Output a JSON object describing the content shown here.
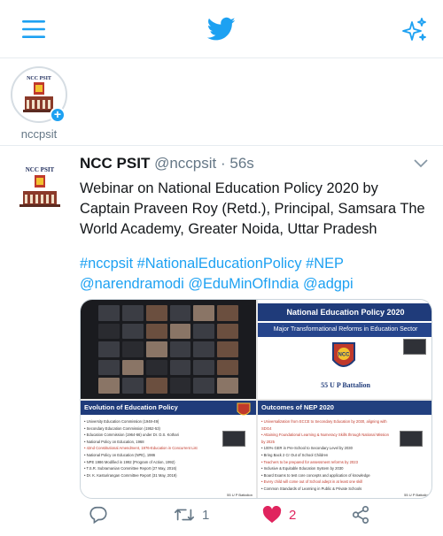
{
  "header": {
    "menu_icon": "hamburger-menu-icon",
    "logo_icon": "twitter-bird-icon",
    "sparkle_icon": "sparkle-icon",
    "accent": "#1da1f2"
  },
  "fleet": {
    "name": "nccpsit",
    "avatar_text": "NCC PSIT"
  },
  "tweet": {
    "avatar_text": "NCC PSIT",
    "name": "NCC PSIT",
    "handle": "@nccpsit",
    "separator": "·",
    "time": "56s",
    "text": "Webinar on National Education Policy 2020 by Captain Praveen Roy (Retd.), Principal, Samsara The World Academy, Greater Noida, Uttar Pradesh",
    "hashtags": "#nccpsit #NationalEducationPolicy #NEP @narendramodi @EduMinOfIndia @adgpi",
    "media": {
      "slide2_title": "National Education Policy 2020",
      "slide2_subtitle": "Major Transformational Reforms in Education Sector",
      "slide2_footer": "55 U P Battalion",
      "slide3_title": "Evolution of Education Policy",
      "slide3_items": [
        "• University Education Commission (1948-49)",
        "• Secondary Education Commission (1952-53)",
        "• Education Commission (1964-66) under Dr. D.S. Kothari",
        "• National Policy on Education, 1968",
        "• 42nd Constitutional Amendment, 1976-Education in Concurrent List",
        "• National Policy on Education (NPE), 1986",
        "• NPE 1986 Modified in 1992 (Program of Action, 1992)",
        "• T.S.R. Subramanian Committee Report (27 May, 2016)",
        "• Dr. K. Kasturirangan Committee Report (31 May, 2019)"
      ],
      "slide3_footer": "55 U P Battalion",
      "slide4_title": "Outcomes of NEP 2020",
      "slide4_items": [
        "• Universalization from ECCE to Secondary Education by 2030, aligning with SDG4",
        "• Attaining Foundational Learning & Numeracy Skills through National Mission by 2025",
        "• 100% GER in Pre-School to Secondary Level by 2030",
        "• Bring Back 2 Cr Out of School Children",
        "• Teachers to be prepared for assessment reforms by 2023",
        "• Inclusive & Equitable Education System by 2030",
        "• Board Exams to test core concepts and application of knowledge",
        "• Every child will come out of School adept in at least one skill",
        "• Common Standards of Learning in Public & Private Schools"
      ],
      "slide4_footer": "55 U P Battalion"
    }
  },
  "actions": {
    "reply_icon": "reply-icon",
    "retweet_icon": "retweet-icon",
    "retweet_count": "1",
    "like_icon": "heart-icon",
    "like_count": "2",
    "like_color": "#e0245e",
    "share_icon": "share-icon"
  }
}
